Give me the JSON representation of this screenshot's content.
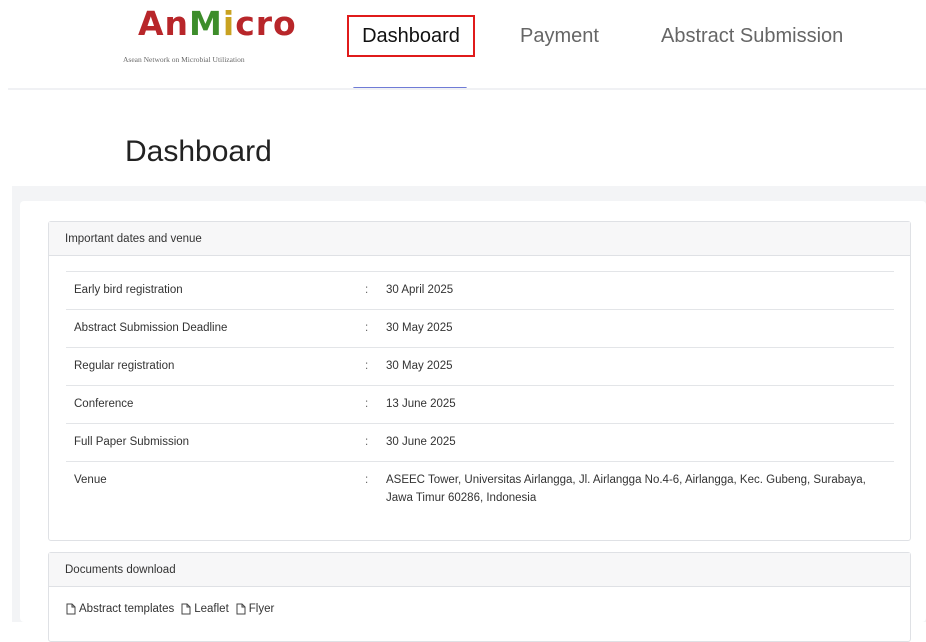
{
  "header": {
    "logo": {
      "wordmark": "AnMicro",
      "tagline": "Asean Network on Microbial Utilization"
    },
    "nav": [
      {
        "label": "Dashboard",
        "active": true
      },
      {
        "label": "Payment",
        "active": false
      },
      {
        "label": "Abstract Submission",
        "active": false
      }
    ]
  },
  "page": {
    "title": "Dashboard"
  },
  "dates_panel": {
    "heading": "Important dates and venue",
    "rows": [
      {
        "label": "Early bird registration",
        "separator": ":",
        "value": "30 April 2025"
      },
      {
        "label": "Abstract Submission Deadline",
        "separator": ":",
        "value": "30 May 2025"
      },
      {
        "label": "Regular registration",
        "separator": ":",
        "value": "30 May 2025"
      },
      {
        "label": "Conference",
        "separator": ":",
        "value": "13 June 2025"
      },
      {
        "label": "Full Paper Submission",
        "separator": ":",
        "value": "30 June 2025"
      },
      {
        "label": "Venue",
        "separator": ":",
        "value": "ASEEC Tower, Universitas Airlangga, Jl. Airlangga No.4-6, Airlangga, Kec. Gubeng, Surabaya, Jawa Timur 60286, Indonesia"
      }
    ]
  },
  "docs_panel": {
    "heading": "Documents download",
    "links": [
      {
        "label": "Abstract templates",
        "icon": "document-icon"
      },
      {
        "label": "Leaflet",
        "icon": "document-icon"
      },
      {
        "label": "Flyer",
        "icon": "document-icon"
      }
    ]
  },
  "colors": {
    "active_outline": "#e01b1b",
    "nav_underline": "#6f7bd6",
    "logo_red": "#b8262a",
    "logo_green": "#3d8d2b",
    "logo_yellow": "#c9a221"
  }
}
